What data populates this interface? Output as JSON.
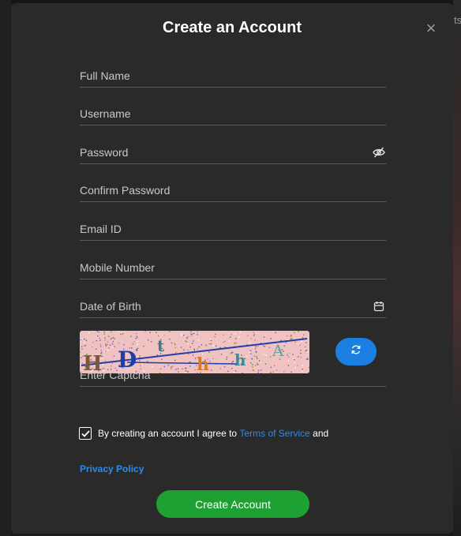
{
  "modal": {
    "title": "Create an Account",
    "close_glyph": "×"
  },
  "background": {
    "edge_text": "ts"
  },
  "fields": {
    "full_name": {
      "placeholder": "Full Name",
      "value": ""
    },
    "username": {
      "placeholder": "Username",
      "value": ""
    },
    "password": {
      "placeholder": "Password",
      "value": "",
      "trailing_icon": "eye-off-icon"
    },
    "confirm_password": {
      "placeholder": "Confirm Password",
      "value": ""
    },
    "email": {
      "placeholder": "Email ID",
      "value": ""
    },
    "mobile": {
      "placeholder": "Mobile Number",
      "value": ""
    },
    "dob": {
      "placeholder": "Date of Birth",
      "value": "",
      "trailing_icon": "calendar-icon"
    },
    "captcha": {
      "placeholder": "Enter Captcha",
      "value": ""
    }
  },
  "captcha_image": {
    "characters": [
      "H",
      "D",
      "t",
      "h",
      "h",
      "A"
    ],
    "refresh_icon": "refresh-icon"
  },
  "agreement": {
    "checked": true,
    "text_before": "By creating an account I agree to ",
    "terms_link": "Terms of Service",
    "text_after": " and",
    "privacy_link": "Privacy Policy"
  },
  "submit": {
    "label": "Create Account"
  },
  "colors": {
    "modal_bg": "#2a2a2a",
    "link": "#2a8ee8",
    "primary_button": "#1fa032",
    "refresh_button": "#1a7fe0",
    "captcha_bg": "#f1c2c2"
  }
}
